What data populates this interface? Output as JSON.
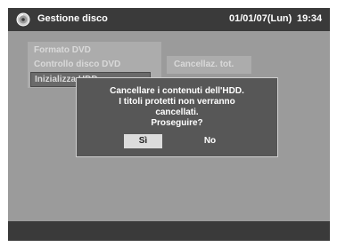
{
  "header": {
    "icon": "disc-icon",
    "title": "Gestione disco",
    "date": "01/01/07(Lun)",
    "time": "19:34"
  },
  "menu": {
    "items": [
      {
        "label": "Formato DVD"
      },
      {
        "label": "Controllo disco DVD"
      },
      {
        "label": "Inizializza HDD"
      }
    ]
  },
  "submenu": {
    "label": "Cancellaz. tot."
  },
  "dialog": {
    "lines": [
      "Cancellare i contenuti dell'HDD.",
      "I titoli protetti non verranno",
      "cancellati.",
      "Proseguire?"
    ],
    "yes_label": "Sì",
    "no_label": "No"
  },
  "colors": {
    "background": "#9b9b9b",
    "header": "#3a3a3a",
    "dialog": "#575757",
    "selected_button": "#dcdcdc"
  }
}
